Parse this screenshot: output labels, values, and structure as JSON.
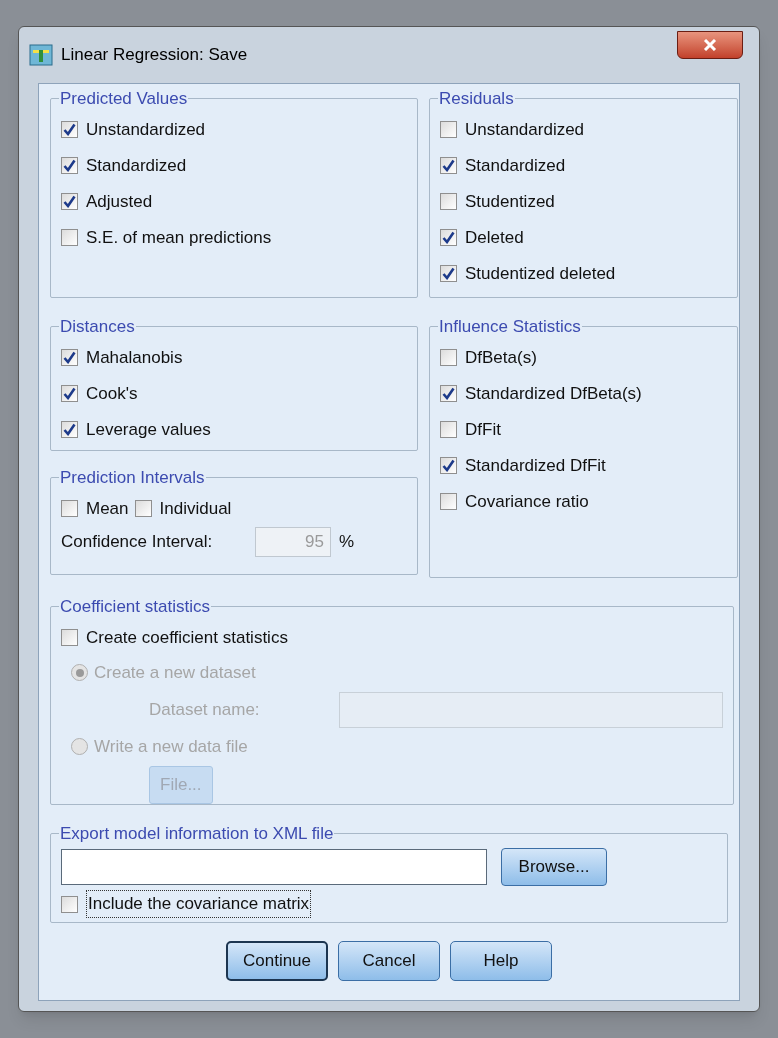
{
  "window": {
    "title": "Linear Regression: Save"
  },
  "predicted_values": {
    "title": "Predicted Values",
    "items": [
      {
        "label": "Unstandardized",
        "checked": true
      },
      {
        "label": "Standardized",
        "checked": true
      },
      {
        "label": "Adjusted",
        "checked": true
      },
      {
        "label": "S.E. of mean predictions",
        "checked": false
      }
    ]
  },
  "residuals": {
    "title": "Residuals",
    "items": [
      {
        "label": "Unstandardized",
        "checked": false
      },
      {
        "label": "Standardized",
        "checked": true
      },
      {
        "label": "Studentized",
        "checked": false
      },
      {
        "label": "Deleted",
        "checked": true
      },
      {
        "label": "Studentized deleted",
        "checked": true
      }
    ]
  },
  "distances": {
    "title": "Distances",
    "items": [
      {
        "label": "Mahalanobis",
        "checked": true
      },
      {
        "label": "Cook's",
        "checked": true
      },
      {
        "label": "Leverage values",
        "checked": true
      }
    ]
  },
  "influence_statistics": {
    "title": "Influence Statistics",
    "items": [
      {
        "label": "DfBeta(s)",
        "checked": false
      },
      {
        "label": "Standardized DfBeta(s)",
        "checked": true
      },
      {
        "label": "DfFit",
        "checked": false
      },
      {
        "label": "Standardized DfFit",
        "checked": true
      },
      {
        "label": "Covariance ratio",
        "checked": false
      }
    ]
  },
  "prediction_intervals": {
    "title": "Prediction Intervals",
    "items": [
      {
        "label": "Mean",
        "checked": false
      },
      {
        "label": "Individual",
        "checked": false
      }
    ],
    "confidence_label": "Confidence Interval:",
    "confidence_value": "95",
    "confidence_unit": "%",
    "confidence_disabled": true
  },
  "coefficient_statistics": {
    "title": "Coefficient statistics",
    "create": {
      "label": "Create coefficient statistics",
      "checked": false
    },
    "options": [
      {
        "label": "Create a new dataset",
        "selected": true,
        "disabled": true
      },
      {
        "label": "Write a new data file",
        "selected": false,
        "disabled": true
      }
    ],
    "dataset_label": "Dataset name:",
    "file_button": "File...",
    "disabled": true
  },
  "export_xml": {
    "title": "Export model information to XML file",
    "browse_button": "Browse...",
    "include": {
      "label": "Include the covariance matrix",
      "checked": false
    }
  },
  "buttons": [
    {
      "label": "Continue",
      "default": true
    },
    {
      "label": "Cancel",
      "default": false
    },
    {
      "label": "Help",
      "default": false
    }
  ]
}
